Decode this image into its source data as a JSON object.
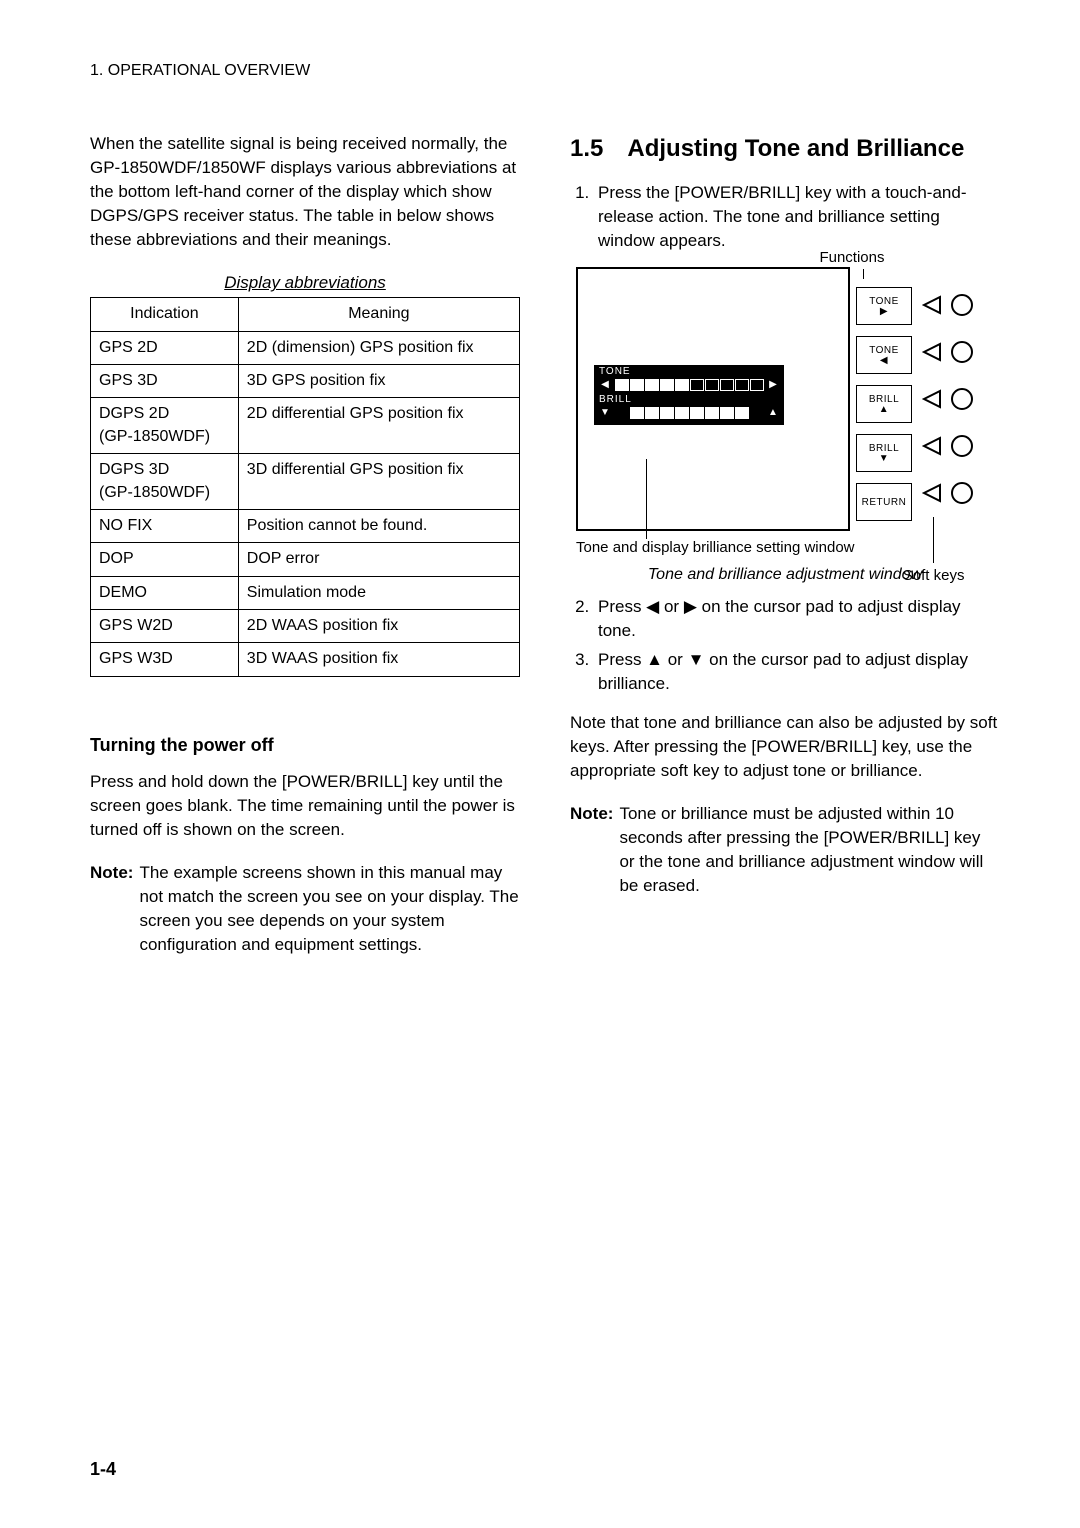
{
  "header": "1. OPERATIONAL OVERVIEW",
  "left": {
    "intro": "When the satellite signal is being received normally, the GP-1850WDF/1850WF displays various abbreviations at the bottom left-hand corner of the display which show DGPS/GPS receiver status. The table in below shows these abbreviations and their meanings.",
    "table_caption": "Display abbreviations",
    "table_headers": [
      "Indication",
      "Meaning"
    ],
    "table_rows": [
      [
        "GPS 2D",
        "2D (dimension) GPS position fix"
      ],
      [
        "GPS 3D",
        "3D GPS position fix"
      ],
      [
        "DGPS 2D\n(GP-1850WDF)",
        "2D differential GPS position fix"
      ],
      [
        "DGPS 3D\n(GP-1850WDF)",
        "3D differential GPS position fix"
      ],
      [
        "NO FIX",
        "Position cannot be found."
      ],
      [
        "DOP",
        "DOP error"
      ],
      [
        "DEMO",
        "Simulation mode"
      ],
      [
        "GPS W2D",
        "2D WAAS position fix"
      ],
      [
        "GPS W3D",
        "3D WAAS position fix"
      ]
    ],
    "sec_heading": "Turning the power off",
    "sec_para": "Press and hold down the [POWER/BRILL] key until the screen goes blank. The time remaining until the power is turned off is shown on the screen.",
    "note_label": "Note:",
    "note_text": "The example screens shown in this manual may not match the screen you see on your display. The screen you see depends on your system configuration and equipment settings."
  },
  "right": {
    "section_num": "1.5",
    "section_title": "Adjusting Tone and Brilliance",
    "step1": "Press the [POWER/BRILL] key with a touch-and-release action. The tone and brilliance setting window appears.",
    "fig": {
      "label_functions": "Functions",
      "label_window": "Tone and display brilliance setting window",
      "label_softkeys": "Soft keys",
      "tone_label": "TONE",
      "brill_label": "BRILL",
      "tone_filled": 5,
      "tone_total": 10,
      "brill_filled": 8,
      "brill_total": 8,
      "softkeys": [
        {
          "text": "TONE",
          "arrow": "▶"
        },
        {
          "text": "TONE",
          "arrow": "◀"
        },
        {
          "text": "BRILL",
          "arrow": "▲"
        },
        {
          "text": "BRILL",
          "arrow": "▼"
        },
        {
          "text": "RETURN",
          "arrow": ""
        }
      ]
    },
    "fig_caption": "Tone and brilliance adjustment window",
    "step2": "Press ◀ or ▶ on the cursor pad to adjust display tone.",
    "step3": "Press ▲ or ▼ on the cursor pad to adjust display brilliance.",
    "para_after": "Note that tone and brilliance can also be adjusted by soft keys. After pressing the [POWER/BRILL] key, use the appropriate soft key to adjust tone or brilliance.",
    "note_label": "Note:",
    "note_text": "Tone or brilliance must be adjusted within 10 seconds after pressing the [POWER/BRILL] key or the tone and brilliance adjustment window will be erased."
  },
  "page_num": "1-4"
}
